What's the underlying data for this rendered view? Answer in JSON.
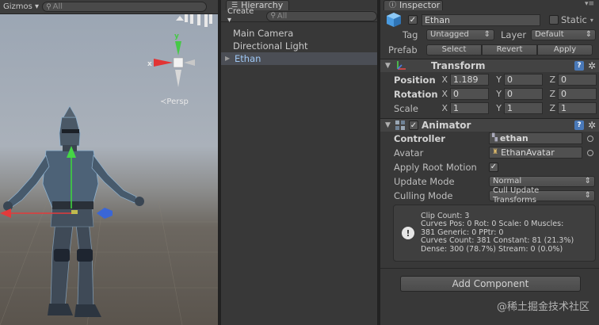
{
  "scene": {
    "gizmos_label": "Gizmos",
    "search_placeholder": "All",
    "persp_label": "Persp",
    "axis_labels": {
      "x": "x",
      "y": "y"
    }
  },
  "hierarchy": {
    "tab_label": "Hierarchy",
    "create_label": "Create",
    "search_placeholder": "All",
    "items": [
      {
        "label": "Main Camera",
        "selected": false
      },
      {
        "label": "Directional Light",
        "selected": false
      },
      {
        "label": "Ethan",
        "selected": true
      }
    ]
  },
  "inspector": {
    "tab_label": "Inspector",
    "object_name": "Ethan",
    "static_label": "Static",
    "tag_label": "Tag",
    "tag_value": "Untagged",
    "layer_label": "Layer",
    "layer_value": "Default",
    "prefab_label": "Prefab",
    "prefab_buttons": [
      "Select",
      "Revert",
      "Apply"
    ],
    "transform": {
      "title": "Transform",
      "position_label": "Position",
      "rotation_label": "Rotation",
      "scale_label": "Scale",
      "axes": [
        "X",
        "Y",
        "Z"
      ],
      "position": [
        "1.189",
        "0",
        "0"
      ],
      "rotation": [
        "0",
        "0",
        "0"
      ],
      "scale": [
        "1",
        "1",
        "1"
      ]
    },
    "animator": {
      "title": "Animator",
      "controller_label": "Controller",
      "controller_value": "ethan",
      "avatar_label": "Avatar",
      "avatar_value": "EthanAvatar",
      "apply_root_motion_label": "Apply Root Motion",
      "update_mode_label": "Update Mode",
      "update_mode_value": "Normal",
      "culling_mode_label": "Culling Mode",
      "culling_mode_value": "Cull Update Transforms",
      "info_lines": [
        "Clip Count: 3",
        "Curves Pos: 0 Rot: 0 Scale: 0 Muscles:",
        "381 Generic: 0 PPtr: 0",
        "Curves Count: 381 Constant: 81 (21.3%)",
        "Dense: 300 (78.7%) Stream: 0 (0.0%)"
      ]
    },
    "add_component_label": "Add Component"
  },
  "watermark": "@稀土掘金技术社区"
}
